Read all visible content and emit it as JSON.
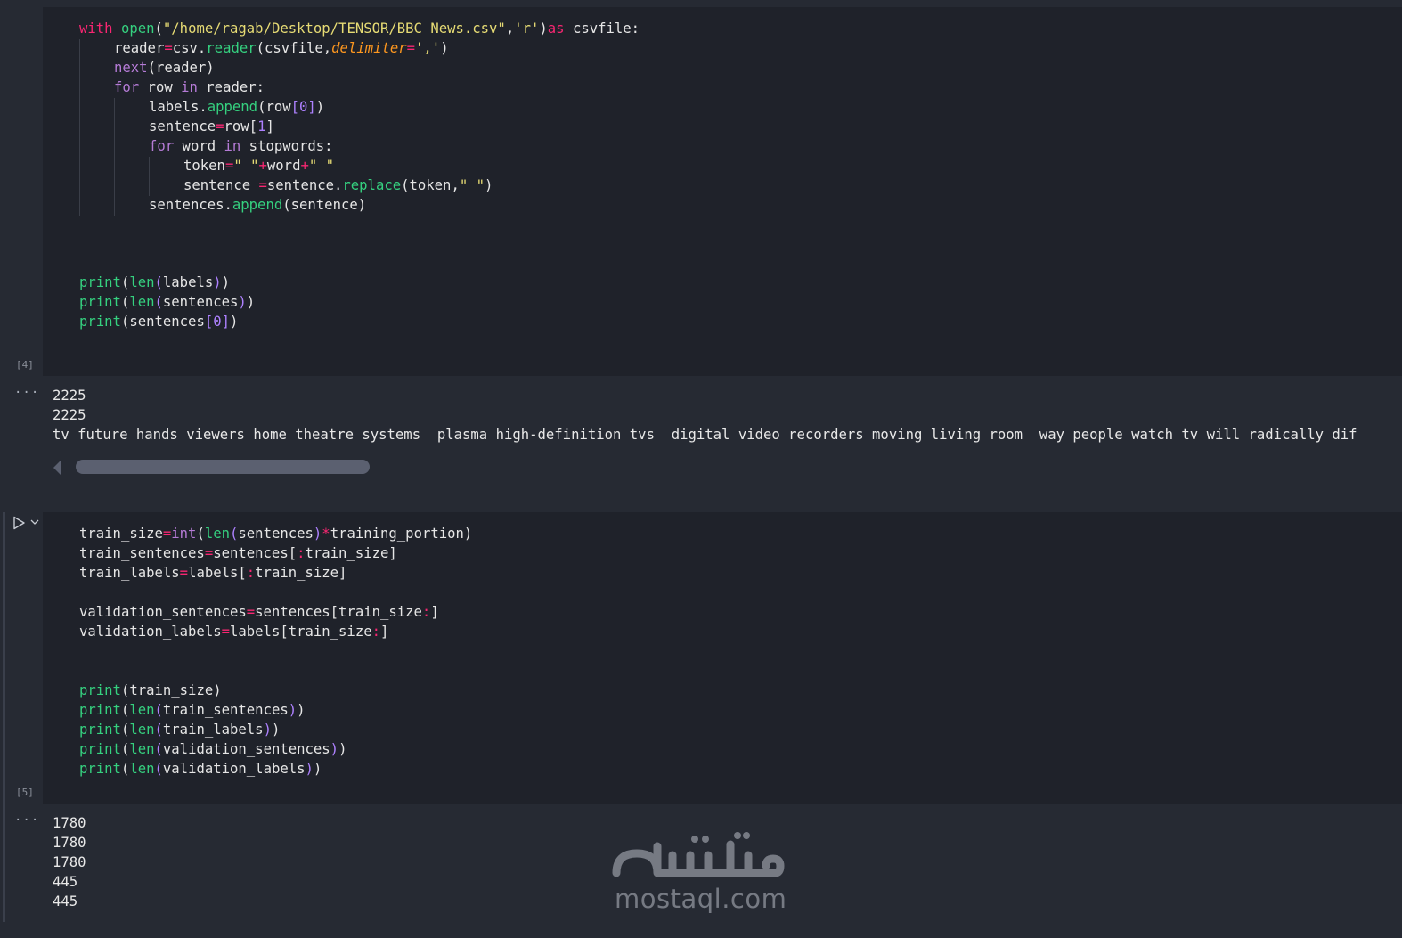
{
  "cell1": {
    "exec_count": "[4]",
    "lines": [
      {
        "seg": [
          [
            "kw",
            "with "
          ],
          [
            "fn",
            "open"
          ],
          [
            "",
            "("
          ],
          [
            "str",
            "\"/home/ragab/Desktop/TENSOR/BBC News.csv\""
          ],
          [
            "",
            ","
          ],
          [
            "str",
            "'r'"
          ],
          [
            "",
            ")"
          ],
          [
            "kw",
            "as"
          ],
          [
            "",
            " csvfile:"
          ]
        ]
      },
      {
        "seg": [
          [
            "",
            "reader"
          ],
          [
            "op",
            "="
          ],
          [
            "",
            "csv."
          ],
          [
            "fn",
            "reader"
          ],
          [
            "",
            "(csvfile,"
          ],
          [
            "param",
            "delimiter"
          ],
          [
            "op",
            "="
          ],
          [
            "str",
            "','"
          ],
          [
            "",
            ")"
          ]
        ]
      },
      {
        "seg": [
          [
            "kw2",
            "next"
          ],
          [
            "",
            "(reader)"
          ]
        ]
      },
      {
        "seg": [
          [
            "kw2",
            "for"
          ],
          [
            "",
            " row "
          ],
          [
            "kw2",
            "in"
          ],
          [
            "",
            " reader:"
          ]
        ]
      },
      {
        "seg": [
          [
            "",
            "labels."
          ],
          [
            "fn",
            "append"
          ],
          [
            "",
            "(row"
          ],
          [
            "num",
            "[0]"
          ],
          [
            "",
            ")"
          ]
        ]
      },
      {
        "seg": [
          [
            "",
            "sentence"
          ],
          [
            "op",
            "="
          ],
          [
            "",
            "row["
          ],
          [
            "num",
            "1"
          ],
          [
            "",
            "]"
          ]
        ]
      },
      {
        "seg": [
          [
            "kw2",
            "for"
          ],
          [
            "",
            " word "
          ],
          [
            "kw2",
            "in"
          ],
          [
            "",
            " stopwords:"
          ]
        ]
      },
      {
        "seg": [
          [
            "",
            "token"
          ],
          [
            "op",
            "="
          ],
          [
            "str",
            "\" \""
          ],
          [
            "op",
            "+"
          ],
          [
            "",
            "word"
          ],
          [
            "op",
            "+"
          ],
          [
            "str",
            "\" \""
          ]
        ]
      },
      {
        "seg": [
          [
            "",
            "sentence "
          ],
          [
            "op",
            "="
          ],
          [
            "",
            "sentence."
          ],
          [
            "fn",
            "replace"
          ],
          [
            "",
            "(token,"
          ],
          [
            "str",
            "\" \""
          ],
          [
            "",
            ")"
          ]
        ]
      },
      {
        "seg": [
          [
            "",
            "sentences."
          ],
          [
            "fn",
            "append"
          ],
          [
            "",
            "(sentence)"
          ]
        ]
      },
      {
        "seg": [
          [
            "fn",
            "print"
          ],
          [
            "",
            "("
          ],
          [
            "fn",
            "len"
          ],
          [
            "num",
            "("
          ],
          [
            "",
            "labels"
          ],
          [
            "num",
            ")"
          ],
          [
            "",
            ")"
          ]
        ]
      },
      {
        "seg": [
          [
            "fn",
            "print"
          ],
          [
            "",
            "("
          ],
          [
            "fn",
            "len"
          ],
          [
            "num",
            "("
          ],
          [
            "",
            "sentences"
          ],
          [
            "num",
            ")"
          ],
          [
            "",
            ")"
          ]
        ]
      },
      {
        "seg": [
          [
            "fn",
            "print"
          ],
          [
            "",
            "(sentences"
          ],
          [
            "num",
            "[0]"
          ],
          [
            "",
            ")"
          ]
        ]
      }
    ]
  },
  "output1": {
    "ellipsis": "···",
    "lines": [
      "2225",
      "2225",
      "tv future hands viewers home theatre systems  plasma high-definition tvs  digital video recorders moving living room  way people watch tv will radically dif"
    ]
  },
  "cell2": {
    "exec_count": "[5]",
    "lines": [
      {
        "seg": [
          [
            "",
            "train_size"
          ],
          [
            "op",
            "="
          ],
          [
            "kw2",
            "int"
          ],
          [
            "",
            "("
          ],
          [
            "fn",
            "len"
          ],
          [
            "num",
            "("
          ],
          [
            "",
            "sentences"
          ],
          [
            "num",
            ")"
          ],
          [
            "op",
            "*"
          ],
          [
            "",
            "training_portion)"
          ]
        ]
      },
      {
        "seg": [
          [
            "",
            "train_sentences"
          ],
          [
            "op",
            "="
          ],
          [
            "",
            "sentences["
          ],
          [
            "op",
            ":"
          ],
          [
            "",
            "train_size]"
          ]
        ]
      },
      {
        "seg": [
          [
            "",
            "train_labels"
          ],
          [
            "op",
            "="
          ],
          [
            "",
            "labels["
          ],
          [
            "op",
            ":"
          ],
          [
            "",
            "train_size]"
          ]
        ]
      },
      {
        "seg": [
          [
            "",
            "validation_sentences"
          ],
          [
            "op",
            "="
          ],
          [
            "",
            "sentences[train_size"
          ],
          [
            "op",
            ":"
          ],
          [
            "",
            "]"
          ]
        ]
      },
      {
        "seg": [
          [
            "",
            "validation_labels"
          ],
          [
            "op",
            "="
          ],
          [
            "",
            "labels[train_size"
          ],
          [
            "op",
            ":"
          ],
          [
            "",
            "]"
          ]
        ]
      },
      {
        "seg": [
          [
            "fn",
            "print"
          ],
          [
            "",
            "(train_size)"
          ]
        ]
      },
      {
        "seg": [
          [
            "fn",
            "print"
          ],
          [
            "",
            "("
          ],
          [
            "fn",
            "len"
          ],
          [
            "num",
            "("
          ],
          [
            "",
            "train_sentences"
          ],
          [
            "num",
            ")"
          ],
          [
            "",
            ")"
          ]
        ]
      },
      {
        "seg": [
          [
            "fn",
            "print"
          ],
          [
            "",
            "("
          ],
          [
            "fn",
            "len"
          ],
          [
            "num",
            "("
          ],
          [
            "",
            "train_labels"
          ],
          [
            "num",
            ")"
          ],
          [
            "",
            ")"
          ]
        ]
      },
      {
        "seg": [
          [
            "fn",
            "print"
          ],
          [
            "",
            "("
          ],
          [
            "fn",
            "len"
          ],
          [
            "num",
            "("
          ],
          [
            "",
            "validation_sentences"
          ],
          [
            "num",
            ")"
          ],
          [
            "",
            ")"
          ]
        ]
      },
      {
        "seg": [
          [
            "fn",
            "print"
          ],
          [
            "",
            "("
          ],
          [
            "fn",
            "len"
          ],
          [
            "num",
            "("
          ],
          [
            "",
            "validation_labels"
          ],
          [
            "num",
            ")"
          ],
          [
            "",
            ")"
          ]
        ]
      }
    ]
  },
  "output2": {
    "ellipsis": "···",
    "lines": [
      "1780",
      "1780",
      "1780",
      "445",
      "445"
    ]
  },
  "watermark": {
    "arabic": "مستقل",
    "latin": "mostaql.com"
  },
  "colors": {
    "background": "#262a33",
    "code_bg": "#1f222a",
    "keyword": "#f92672",
    "builtin": "#b57bd6",
    "function": "#35d07f",
    "string": "#e6db74",
    "number": "#ae81ff",
    "param": "#fd971f"
  },
  "icons": {
    "run": "play-icon",
    "expand": "chevron-down-icon",
    "scroll_left": "scroll-left-arrow-icon"
  }
}
